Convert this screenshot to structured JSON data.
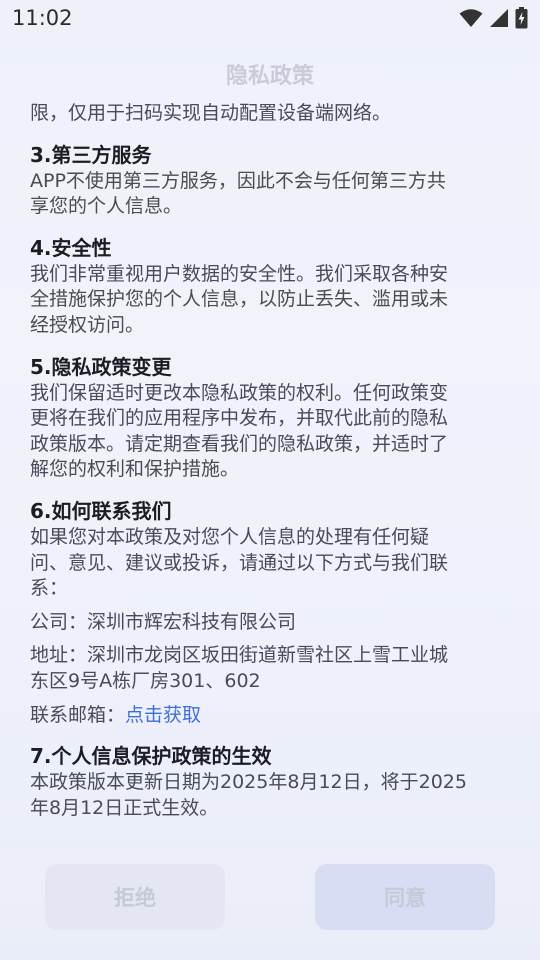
{
  "status_bar": {
    "time": "11:02",
    "icons": [
      "wifi-icon",
      "cellular-signal-icon",
      "battery-charging-icon"
    ]
  },
  "dialog": {
    "title": "隐私政策",
    "partial_first_line": "限，仅用于扫码实现自动配置设备端网络。",
    "sections": [
      {
        "heading": "3.第三方服务",
        "lines": [
          "APP不使用第三方服务，因此不会与任何第三方共",
          "享您的个人信息。"
        ]
      },
      {
        "heading": "4.安全性",
        "lines": [
          "我们非常重视用户数据的安全性。我们采取各种安",
          "全措施保护您的个人信息，以防止丢失、滥用或未",
          "经授权访问。"
        ]
      },
      {
        "heading": "5.隐私政策变更",
        "lines": [
          "我们保留适时更改本隐私政策的权利。任何政策变",
          "更将在我们的应用程序中发布，并取代此前的隐私",
          "政策版本。请定期查看我们的隐私政策，并适时了",
          "解您的权利和保护措施。"
        ]
      },
      {
        "heading": "6.如何联系我们",
        "lines": [
          "如果您对本政策及对您个人信息的处理有任何疑",
          "问、意见、建议或投诉，请通过以下方式与我们联",
          "系："
        ],
        "company": "公司：深圳市辉宏科技有限公司",
        "address_lines": [
          "地址：深圳市龙岗区坂田街道新雪社区上雪工业城",
          "东区9号A栋厂房301、602"
        ],
        "email_label": "联系邮箱：",
        "email_link": "点击获取"
      },
      {
        "heading": "7.个人信息保护政策的生效",
        "lines": [
          "本政策版本更新日期为2025年8月12日，将于2025",
          "年8月12日正式生效。"
        ]
      }
    ],
    "buttons": {
      "reject": "拒绝",
      "agree": "同意"
    },
    "colors": {
      "link": "#3e6fd6",
      "heading": "#1c1c24",
      "body_text": "#4b4b55",
      "disabled_button_text": "#c6c9d7"
    }
  }
}
